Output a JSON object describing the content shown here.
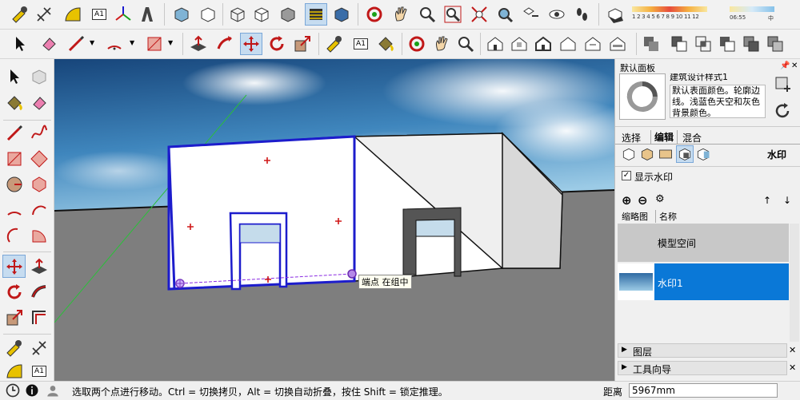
{
  "toolbar_top": {
    "style_label": "A1",
    "legend_ticks": "1 2 3 4 5 6 7 8 9 10 11 12",
    "time_value": "06:55",
    "time_suffix": "中"
  },
  "toolbar_second": {
    "text_tool_label": "A1"
  },
  "left_toolbar": {
    "text_tool_label": "A1"
  },
  "viewport": {
    "tooltip": "端点 在组中"
  },
  "panel": {
    "title": "默认面板",
    "style_name": "建筑设计样式1",
    "style_description": "默认表面颜色。轮廓边线。浅蓝色天空和灰色背景颜色。",
    "tabs": [
      "选择",
      "编辑",
      "混合"
    ],
    "watermark_section_label": "水印",
    "show_watermark_label": "显示水印",
    "list_header_thumb": "缩略图",
    "list_header_name": "名称",
    "model_space_label": "模型空间",
    "watermark_item_label": "水印1",
    "collapsed_section_1": "图层",
    "collapsed_section_2": "工具向导"
  },
  "status_bar": {
    "message": "选取两个点进行移动。Ctrl = 切换拷贝，Alt = 切换自动折叠，按住 Shift = 锁定推理。",
    "measure_label": "距离",
    "measure_value": "5967mm"
  },
  "colors": {
    "selection_blue": "#1c1ccc",
    "sky_top": "#1b4f86",
    "ground": "#7e7e7e",
    "panel_highlight": "#0a78d7"
  }
}
